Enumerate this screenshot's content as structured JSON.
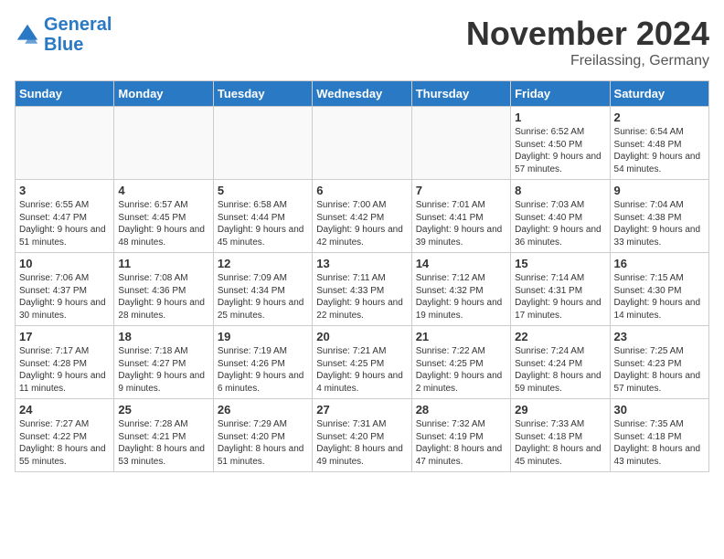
{
  "header": {
    "logo_line1": "General",
    "logo_line2": "Blue",
    "month_title": "November 2024",
    "location": "Freilassing, Germany"
  },
  "weekdays": [
    "Sunday",
    "Monday",
    "Tuesday",
    "Wednesday",
    "Thursday",
    "Friday",
    "Saturday"
  ],
  "weeks": [
    [
      {
        "day": "",
        "info": ""
      },
      {
        "day": "",
        "info": ""
      },
      {
        "day": "",
        "info": ""
      },
      {
        "day": "",
        "info": ""
      },
      {
        "day": "",
        "info": ""
      },
      {
        "day": "1",
        "info": "Sunrise: 6:52 AM\nSunset: 4:50 PM\nDaylight: 9 hours and 57 minutes."
      },
      {
        "day": "2",
        "info": "Sunrise: 6:54 AM\nSunset: 4:48 PM\nDaylight: 9 hours and 54 minutes."
      }
    ],
    [
      {
        "day": "3",
        "info": "Sunrise: 6:55 AM\nSunset: 4:47 PM\nDaylight: 9 hours and 51 minutes."
      },
      {
        "day": "4",
        "info": "Sunrise: 6:57 AM\nSunset: 4:45 PM\nDaylight: 9 hours and 48 minutes."
      },
      {
        "day": "5",
        "info": "Sunrise: 6:58 AM\nSunset: 4:44 PM\nDaylight: 9 hours and 45 minutes."
      },
      {
        "day": "6",
        "info": "Sunrise: 7:00 AM\nSunset: 4:42 PM\nDaylight: 9 hours and 42 minutes."
      },
      {
        "day": "7",
        "info": "Sunrise: 7:01 AM\nSunset: 4:41 PM\nDaylight: 9 hours and 39 minutes."
      },
      {
        "day": "8",
        "info": "Sunrise: 7:03 AM\nSunset: 4:40 PM\nDaylight: 9 hours and 36 minutes."
      },
      {
        "day": "9",
        "info": "Sunrise: 7:04 AM\nSunset: 4:38 PM\nDaylight: 9 hours and 33 minutes."
      }
    ],
    [
      {
        "day": "10",
        "info": "Sunrise: 7:06 AM\nSunset: 4:37 PM\nDaylight: 9 hours and 30 minutes."
      },
      {
        "day": "11",
        "info": "Sunrise: 7:08 AM\nSunset: 4:36 PM\nDaylight: 9 hours and 28 minutes."
      },
      {
        "day": "12",
        "info": "Sunrise: 7:09 AM\nSunset: 4:34 PM\nDaylight: 9 hours and 25 minutes."
      },
      {
        "day": "13",
        "info": "Sunrise: 7:11 AM\nSunset: 4:33 PM\nDaylight: 9 hours and 22 minutes."
      },
      {
        "day": "14",
        "info": "Sunrise: 7:12 AM\nSunset: 4:32 PM\nDaylight: 9 hours and 19 minutes."
      },
      {
        "day": "15",
        "info": "Sunrise: 7:14 AM\nSunset: 4:31 PM\nDaylight: 9 hours and 17 minutes."
      },
      {
        "day": "16",
        "info": "Sunrise: 7:15 AM\nSunset: 4:30 PM\nDaylight: 9 hours and 14 minutes."
      }
    ],
    [
      {
        "day": "17",
        "info": "Sunrise: 7:17 AM\nSunset: 4:28 PM\nDaylight: 9 hours and 11 minutes."
      },
      {
        "day": "18",
        "info": "Sunrise: 7:18 AM\nSunset: 4:27 PM\nDaylight: 9 hours and 9 minutes."
      },
      {
        "day": "19",
        "info": "Sunrise: 7:19 AM\nSunset: 4:26 PM\nDaylight: 9 hours and 6 minutes."
      },
      {
        "day": "20",
        "info": "Sunrise: 7:21 AM\nSunset: 4:25 PM\nDaylight: 9 hours and 4 minutes."
      },
      {
        "day": "21",
        "info": "Sunrise: 7:22 AM\nSunset: 4:25 PM\nDaylight: 9 hours and 2 minutes."
      },
      {
        "day": "22",
        "info": "Sunrise: 7:24 AM\nSunset: 4:24 PM\nDaylight: 8 hours and 59 minutes."
      },
      {
        "day": "23",
        "info": "Sunrise: 7:25 AM\nSunset: 4:23 PM\nDaylight: 8 hours and 57 minutes."
      }
    ],
    [
      {
        "day": "24",
        "info": "Sunrise: 7:27 AM\nSunset: 4:22 PM\nDaylight: 8 hours and 55 minutes."
      },
      {
        "day": "25",
        "info": "Sunrise: 7:28 AM\nSunset: 4:21 PM\nDaylight: 8 hours and 53 minutes."
      },
      {
        "day": "26",
        "info": "Sunrise: 7:29 AM\nSunset: 4:20 PM\nDaylight: 8 hours and 51 minutes."
      },
      {
        "day": "27",
        "info": "Sunrise: 7:31 AM\nSunset: 4:20 PM\nDaylight: 8 hours and 49 minutes."
      },
      {
        "day": "28",
        "info": "Sunrise: 7:32 AM\nSunset: 4:19 PM\nDaylight: 8 hours and 47 minutes."
      },
      {
        "day": "29",
        "info": "Sunrise: 7:33 AM\nSunset: 4:18 PM\nDaylight: 8 hours and 45 minutes."
      },
      {
        "day": "30",
        "info": "Sunrise: 7:35 AM\nSunset: 4:18 PM\nDaylight: 8 hours and 43 minutes."
      }
    ]
  ]
}
